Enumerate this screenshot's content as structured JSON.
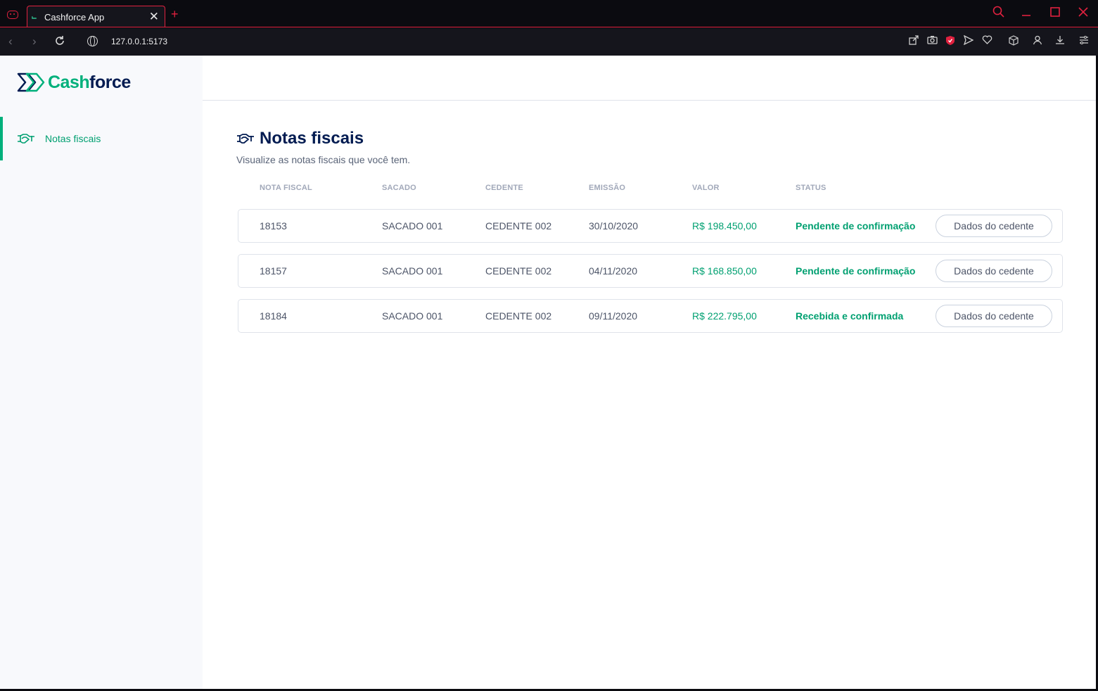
{
  "browser": {
    "tab_title": "Cashforce App",
    "url": "127.0.0.1:5173"
  },
  "sidebar": {
    "logo": {
      "part1": "Cash",
      "part2": "force"
    },
    "items": [
      {
        "label": "Notas fiscais",
        "active": true
      }
    ]
  },
  "page": {
    "title": "Notas fiscais",
    "subtitle": "Visualize as notas fiscais que você tem."
  },
  "table": {
    "columns": [
      "NOTA FISCAL",
      "SACADO",
      "CEDENTE",
      "EMISSÃO",
      "VALOR",
      "STATUS"
    ],
    "rows": [
      {
        "nota": "18153",
        "sacado": "SACADO 001",
        "cedente": "CEDENTE 002",
        "emissao": "30/10/2020",
        "valor": "R$ 198.450,00",
        "status": "Pendente de confirmação",
        "action": "Dados do cedente"
      },
      {
        "nota": "18157",
        "sacado": "SACADO 001",
        "cedente": "CEDENTE 002",
        "emissao": "04/11/2020",
        "valor": "R$ 168.850,00",
        "status": "Pendente de confirmação",
        "action": "Dados do cedente"
      },
      {
        "nota": "18184",
        "sacado": "SACADO 001",
        "cedente": "CEDENTE 002",
        "emissao": "09/11/2020",
        "valor": "R$ 222.795,00",
        "status": "Recebida e confirmada",
        "action": "Dados do cedente"
      }
    ]
  },
  "colors": {
    "brand_green": "#00b07b",
    "brand_navy": "#021b51",
    "browser_accent": "#e0213f"
  }
}
